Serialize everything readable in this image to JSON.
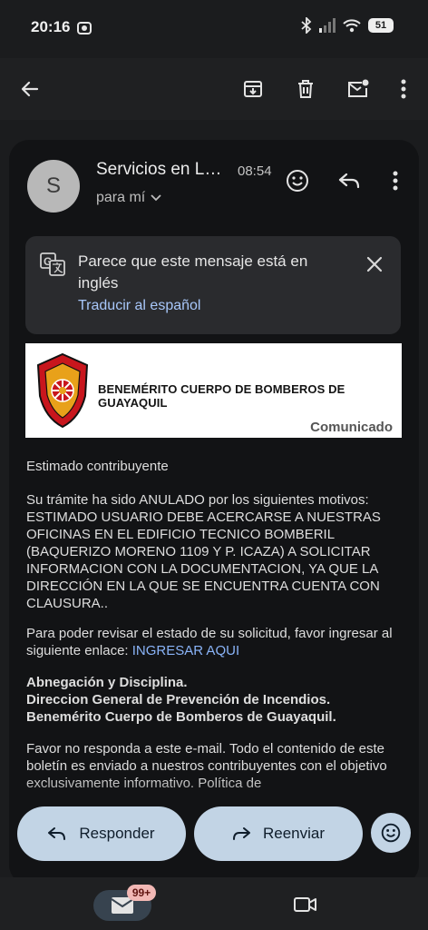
{
  "status": {
    "time": "20:16",
    "battery": "51"
  },
  "header": {
    "sender": "Servicios en Línea",
    "time": "08:54",
    "recipient": "para mí",
    "avatar_letter": "S"
  },
  "translate": {
    "message": "Parece que este mensaje está en inglés",
    "action": "Traducir al español"
  },
  "banner": {
    "title": "BENEMÉRITO CUERPO DE BOMBEROS DE GUAYAQUIL",
    "subtitle": "Comunicado"
  },
  "body": {
    "greeting": "Estimado contribuyente",
    "p1": "Su trámite ha sido ANULADO por los siguientes motivos: ESTIMADO USUARIO DEBE ACERCARSE A NUESTRAS OFICINAS EN EL EDIFICIO TECNICO BOMBERIL (BAQUERIZO MORENO 1109 Y P. ICAZA) A SOLICITAR INFORMACION CON LA DOCUMENTACION, YA QUE LA DIRECCIÓN EN LA QUE SE ENCUENTRA CUENTA CON CLAUSURA..",
    "p2": "Para poder revisar el estado de su solicitud, favor ingresar al siguiente enlace: ",
    "p2_link": "INGRESAR AQUI",
    "sig1": "Abnegación y Disciplina.",
    "sig2": "Direccion General de Prevención de Incendios.",
    "sig3": "Benemérito Cuerpo de Bomberos de Guayaquil.",
    "p3": "Favor no responda a este e-mail. Todo el contenido de este boletín es enviado a nuestros contribuyentes con el objetivo exclusivamente informativo. Política de"
  },
  "actions": {
    "reply": "Responder",
    "forward": "Reenviar"
  },
  "nav": {
    "badge": "99+"
  },
  "colors": {
    "accent": "#a8c7fa",
    "pill": "#c2d4e5",
    "badge": "#f2b8b5"
  }
}
